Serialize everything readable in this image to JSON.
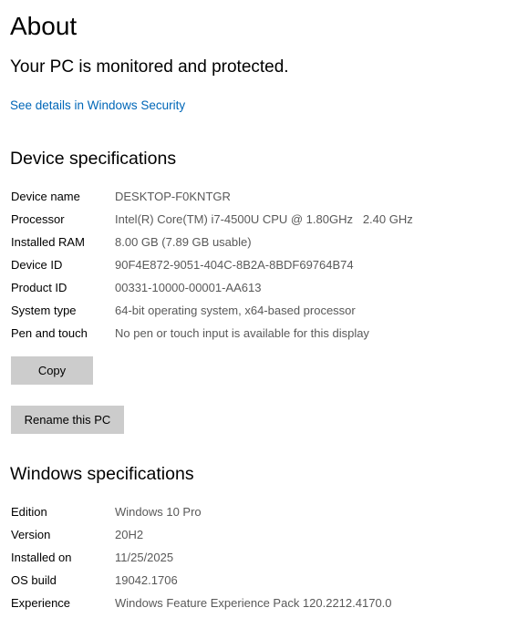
{
  "page": {
    "title": "About"
  },
  "security": {
    "status": "Your PC is monitored and protected.",
    "link_label": "See details in Windows Security"
  },
  "device_specs": {
    "heading": "Device specifications",
    "rows": [
      {
        "label": "Device name",
        "value": "DESKTOP-F0KNTGR"
      },
      {
        "label": "Processor",
        "value": "Intel(R) Core(TM) i7-4500U CPU @ 1.80GHz   2.40 GHz"
      },
      {
        "label": "Installed RAM",
        "value": "8.00 GB (7.89 GB usable)"
      },
      {
        "label": "Device ID",
        "value": "90F4E872-9051-404C-8B2A-8BDF69764B74"
      },
      {
        "label": "Product ID",
        "value": "00331-10000-00001-AA613"
      },
      {
        "label": "System type",
        "value": "64-bit operating system, x64-based processor"
      },
      {
        "label": "Pen and touch",
        "value": "No pen or touch input is available for this display"
      }
    ],
    "copy_label": "Copy",
    "rename_label": "Rename this PC"
  },
  "windows_specs": {
    "heading": "Windows specifications",
    "rows": [
      {
        "label": "Edition",
        "value": "Windows 10 Pro"
      },
      {
        "label": "Version",
        "value": "20H2"
      },
      {
        "label": "Installed on",
        "value": "11/25/2025"
      },
      {
        "label": "OS build",
        "value": "19042.1706"
      },
      {
        "label": "Experience",
        "value": "Windows Feature Experience Pack 120.2212.4170.0"
      }
    ]
  }
}
